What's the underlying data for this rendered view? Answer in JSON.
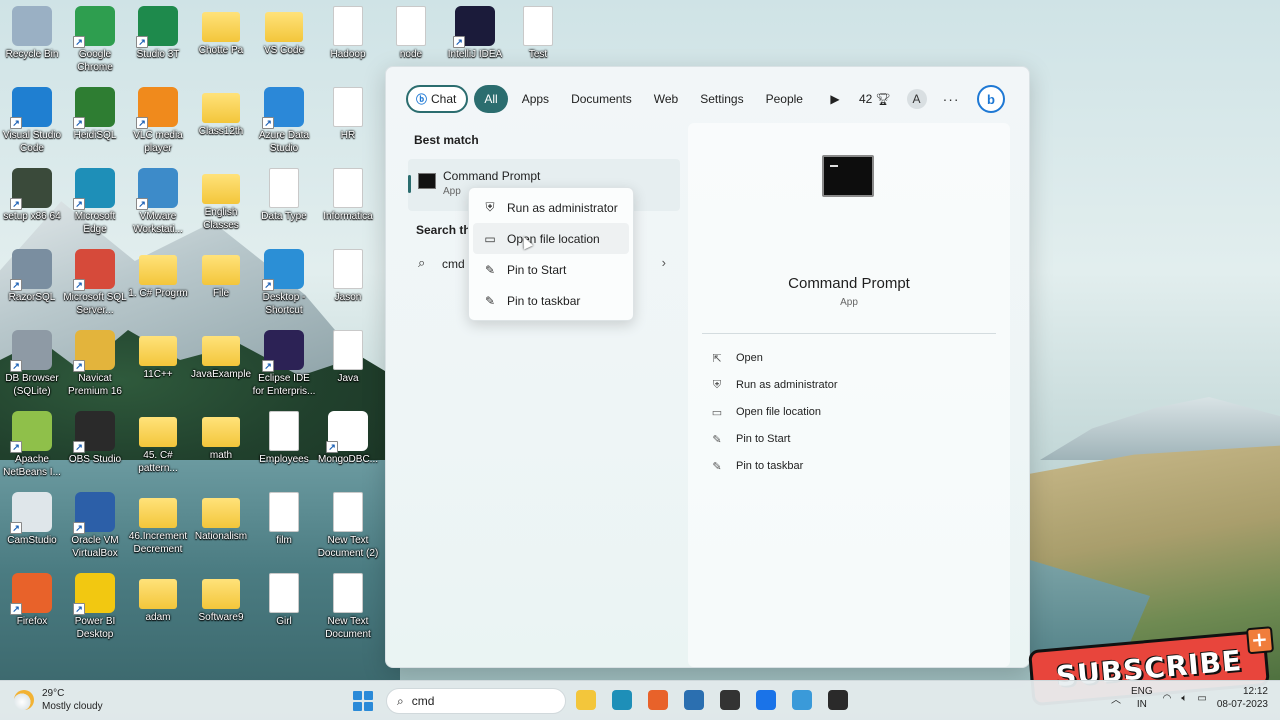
{
  "desktop": {
    "icons": [
      {
        "label": "Recycle Bin",
        "icon": "recycle-bin-icon",
        "kind": "app",
        "color": "#9ab0c4"
      },
      {
        "label": "Google Chrome",
        "icon": "chrome-icon",
        "kind": "app",
        "color": "#2e9e4f"
      },
      {
        "label": "Studio 3T",
        "icon": "studio3t-icon",
        "kind": "app",
        "color": "#1e8a4c"
      },
      {
        "label": "Chotte Pa",
        "icon": "folder-icon",
        "kind": "folder",
        "color": "#f3c63b"
      },
      {
        "label": "VS Code",
        "icon": "folder-icon",
        "kind": "folder",
        "color": "#f3c63b"
      },
      {
        "label": "Hadoop",
        "icon": "file-icon",
        "kind": "file",
        "color": "#ffffff"
      },
      {
        "label": "node",
        "icon": "file-icon",
        "kind": "file",
        "color": "#ffffff"
      },
      {
        "label": "IntelliJ IDEA",
        "icon": "intellij-icon",
        "kind": "app",
        "color": "#1b1b3a"
      },
      {
        "label": "Test",
        "icon": "file-icon",
        "kind": "file",
        "color": "#ffffff"
      },
      {
        "label": "Visual Studio Code",
        "icon": "vscode-icon",
        "kind": "app",
        "color": "#1f7fd1"
      },
      {
        "label": "HeidiSQL",
        "icon": "heidisql-icon",
        "kind": "app",
        "color": "#2e7d32"
      },
      {
        "label": "VLC media player",
        "icon": "vlc-icon",
        "kind": "app",
        "color": "#f08a1c"
      },
      {
        "label": "Class12th",
        "icon": "folder-icon",
        "kind": "folder",
        "color": "#f3c63b"
      },
      {
        "label": "Azure Data Studio",
        "icon": "azure-data-studio-icon",
        "kind": "app",
        "color": "#2b88d8"
      },
      {
        "label": "HR",
        "icon": "hr-icon",
        "kind": "file",
        "color": "#ffffff"
      },
      {
        "label": "setup x86 64",
        "icon": "setup-icon",
        "kind": "app",
        "color": "#3a4a3a"
      },
      {
        "label": "Microsoft Edge",
        "icon": "edge-icon",
        "kind": "app",
        "color": "#1e8fb8"
      },
      {
        "label": "VMware Workstati...",
        "icon": "vmware-icon",
        "kind": "app",
        "color": "#3d8bc9"
      },
      {
        "label": "English Classes",
        "icon": "folder-icon",
        "kind": "folder",
        "color": "#f3c63b"
      },
      {
        "label": "Data Type",
        "icon": "file-icon",
        "kind": "file",
        "color": "#ffffff"
      },
      {
        "label": "Informatica",
        "icon": "file-icon",
        "kind": "file",
        "color": "#ffffff"
      },
      {
        "label": "RazorSQL",
        "icon": "razorsql-icon",
        "kind": "app",
        "color": "#7a8ea0"
      },
      {
        "label": "Microsoft SQL Server...",
        "icon": "sql-server-icon",
        "kind": "app",
        "color": "#d64a3a"
      },
      {
        "label": "1. C# Progrm",
        "icon": "folder-icon",
        "kind": "folder",
        "color": "#f3c63b"
      },
      {
        "label": "File",
        "icon": "folder-icon",
        "kind": "folder",
        "color": "#f3c63b"
      },
      {
        "label": "Desktop - Shortcut",
        "icon": "desktop-shortcut-icon",
        "kind": "app",
        "color": "#2b8fd6"
      },
      {
        "label": "Jason",
        "icon": "file-icon",
        "kind": "file",
        "color": "#ffffff"
      },
      {
        "label": "DB Browser (SQLite)",
        "icon": "db-browser-icon",
        "kind": "app",
        "color": "#8e9aa5"
      },
      {
        "label": "Navicat Premium 16",
        "icon": "navicat-icon",
        "kind": "app",
        "color": "#e3b43c"
      },
      {
        "label": "11C++",
        "icon": "folder-icon",
        "kind": "folder",
        "color": "#f3c63b"
      },
      {
        "label": "JavaExample",
        "icon": "folder-icon",
        "kind": "folder",
        "color": "#f3c63b"
      },
      {
        "label": "Eclipse IDE for Enterpris...",
        "icon": "eclipse-icon",
        "kind": "app",
        "color": "#2c2255"
      },
      {
        "label": "Java",
        "icon": "file-icon",
        "kind": "file",
        "color": "#ffffff"
      },
      {
        "label": "Apache NetBeans I...",
        "icon": "netbeans-icon",
        "kind": "app",
        "color": "#8fc04a"
      },
      {
        "label": "OBS Studio",
        "icon": "obs-icon",
        "kind": "app",
        "color": "#2a2a2a"
      },
      {
        "label": "45. C# pattern...",
        "icon": "folder-icon",
        "kind": "folder",
        "color": "#f3c63b"
      },
      {
        "label": "math",
        "icon": "folder-icon",
        "kind": "folder",
        "color": "#f3c63b"
      },
      {
        "label": "Employees",
        "icon": "file-icon",
        "kind": "file",
        "color": "#ffffff"
      },
      {
        "label": "MongoDBC...",
        "icon": "mongodb-icon",
        "kind": "app",
        "color": "#ffffff"
      },
      {
        "label": "CamStudio",
        "icon": "camstudio-icon",
        "kind": "app",
        "color": "#dfe6ea"
      },
      {
        "label": "Oracle VM VirtualBox",
        "icon": "virtualbox-icon",
        "kind": "app",
        "color": "#2c5fa8"
      },
      {
        "label": "46.Increment Decrement",
        "icon": "folder-icon",
        "kind": "folder",
        "color": "#f3c63b"
      },
      {
        "label": "Nationalism",
        "icon": "folder-icon",
        "kind": "folder",
        "color": "#f3c63b"
      },
      {
        "label": "film",
        "icon": "file-icon",
        "kind": "file",
        "color": "#ffffff"
      },
      {
        "label": "New Text Document (2)",
        "icon": "file-icon",
        "kind": "file",
        "color": "#ffffff"
      },
      {
        "label": "Firefox",
        "icon": "firefox-icon",
        "kind": "app",
        "color": "#e8622a"
      },
      {
        "label": "Power BI Desktop",
        "icon": "powerbi-icon",
        "kind": "app",
        "color": "#f2c811"
      },
      {
        "label": "adam",
        "icon": "folder-icon",
        "kind": "folder",
        "color": "#f3c63b"
      },
      {
        "label": "Software9",
        "icon": "folder-icon",
        "kind": "folder",
        "color": "#f3c63b"
      },
      {
        "label": "Girl",
        "icon": "file-icon",
        "kind": "file",
        "color": "#ffffff"
      },
      {
        "label": "New Text Document",
        "icon": "file-icon",
        "kind": "file",
        "color": "#ffffff"
      }
    ]
  },
  "search_panel": {
    "filters": {
      "chat": "Chat",
      "all": "All",
      "apps": "Apps",
      "documents": "Documents",
      "web": "Web",
      "settings": "Settings",
      "people": "People",
      "rewards_count": "42",
      "avatar_letter": "A",
      "more": "···",
      "bing_letter": "b"
    },
    "best_match_heading": "Best match",
    "best_match": {
      "name": "Command Prompt",
      "type": "App"
    },
    "search_web_heading": "Search the",
    "search_web_query": "cmd",
    "context_menu": [
      {
        "label": "Run as administrator",
        "icon": "shield-icon"
      },
      {
        "label": "Open file location",
        "icon": "folder-open-icon"
      },
      {
        "label": "Pin to Start",
        "icon": "pin-icon"
      },
      {
        "label": "Pin to taskbar",
        "icon": "pin-icon"
      }
    ],
    "detail": {
      "title": "Command Prompt",
      "type": "App",
      "actions": [
        {
          "label": "Open",
          "icon": "open-external-icon"
        },
        {
          "label": "Run as administrator",
          "icon": "shield-icon"
        },
        {
          "label": "Open file location",
          "icon": "folder-open-icon"
        },
        {
          "label": "Pin to Start",
          "icon": "pin-icon"
        },
        {
          "label": "Pin to taskbar",
          "icon": "pin-icon"
        }
      ]
    },
    "accent": "#2b6d6f"
  },
  "overlay": {
    "subscribe_text": "SUBSCRIBE",
    "plus": "+"
  },
  "taskbar": {
    "weather_temp": "29°C",
    "weather_desc": "Mostly cloudy",
    "search_value": "cmd",
    "apps": [
      {
        "icon": "file-explorer-icon",
        "color": "#f3c63b"
      },
      {
        "icon": "edge-icon",
        "color": "#1e8fb8"
      },
      {
        "icon": "firefox-icon",
        "color": "#e8622a"
      },
      {
        "icon": "store-icon",
        "color": "#2b6fb0"
      },
      {
        "icon": "unity-icon",
        "color": "#333333"
      },
      {
        "icon": "app-icon",
        "color": "#1a73e8"
      },
      {
        "icon": "notepad-icon",
        "color": "#3a9ad9"
      },
      {
        "icon": "obs-icon",
        "color": "#2a2a2a"
      }
    ],
    "lang_top": "ENG",
    "lang_bottom": "IN",
    "time": "12:12",
    "date": "08-07-2023"
  }
}
